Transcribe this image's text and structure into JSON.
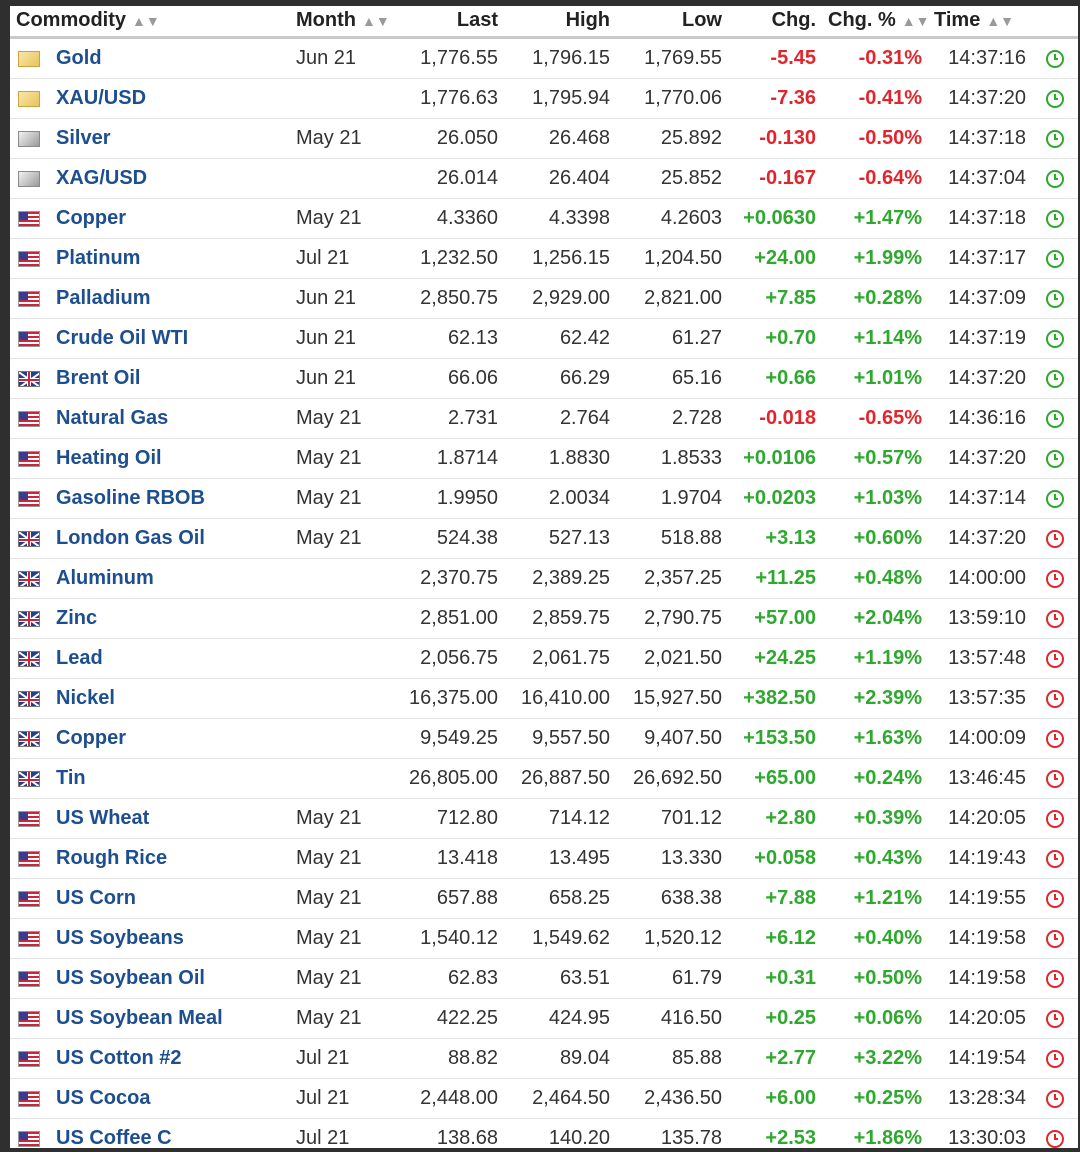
{
  "columns": {
    "commodity": "Commodity",
    "month": "Month",
    "last": "Last",
    "high": "High",
    "low": "Low",
    "chg": "Chg.",
    "chg_pct": "Chg. %",
    "time": "Time"
  },
  "sort_icon": "sort-icon",
  "colors": {
    "up": "#2ea82e",
    "down": "#e0262c",
    "link": "#1d4e8f",
    "open": "#2ea82e",
    "closed": "#e0262c"
  },
  "rows": [
    {
      "flag": "gold",
      "name": "Gold",
      "month": "Jun 21",
      "last": "1,776.55",
      "high": "1,796.15",
      "low": "1,769.55",
      "chg": "-5.45",
      "pct": "-0.31%",
      "time": "14:37:16",
      "dir": "down",
      "clock": "green"
    },
    {
      "flag": "gold",
      "name": "XAU/USD",
      "month": "",
      "last": "1,776.63",
      "high": "1,795.94",
      "low": "1,770.06",
      "chg": "-7.36",
      "pct": "-0.41%",
      "time": "14:37:20",
      "dir": "down",
      "clock": "green"
    },
    {
      "flag": "silver",
      "name": "Silver",
      "month": "May 21",
      "last": "26.050",
      "high": "26.468",
      "low": "25.892",
      "chg": "-0.130",
      "pct": "-0.50%",
      "time": "14:37:18",
      "dir": "down",
      "clock": "green"
    },
    {
      "flag": "silver",
      "name": "XAG/USD",
      "month": "",
      "last": "26.014",
      "high": "26.404",
      "low": "25.852",
      "chg": "-0.167",
      "pct": "-0.64%",
      "time": "14:37:04",
      "dir": "down",
      "clock": "green"
    },
    {
      "flag": "us",
      "name": "Copper",
      "month": "May 21",
      "last": "4.3360",
      "high": "4.3398",
      "low": "4.2603",
      "chg": "+0.0630",
      "pct": "+1.47%",
      "time": "14:37:18",
      "dir": "up",
      "clock": "green"
    },
    {
      "flag": "us",
      "name": "Platinum",
      "month": "Jul 21",
      "last": "1,232.50",
      "high": "1,256.15",
      "low": "1,204.50",
      "chg": "+24.00",
      "pct": "+1.99%",
      "time": "14:37:17",
      "dir": "up",
      "clock": "green"
    },
    {
      "flag": "us",
      "name": "Palladium",
      "month": "Jun 21",
      "last": "2,850.75",
      "high": "2,929.00",
      "low": "2,821.00",
      "chg": "+7.85",
      "pct": "+0.28%",
      "time": "14:37:09",
      "dir": "up",
      "clock": "green"
    },
    {
      "flag": "us",
      "name": "Crude Oil WTI",
      "month": "Jun 21",
      "last": "62.13",
      "high": "62.42",
      "low": "61.27",
      "chg": "+0.70",
      "pct": "+1.14%",
      "time": "14:37:19",
      "dir": "up",
      "clock": "green"
    },
    {
      "flag": "uk",
      "name": "Brent Oil",
      "month": "Jun 21",
      "last": "66.06",
      "high": "66.29",
      "low": "65.16",
      "chg": "+0.66",
      "pct": "+1.01%",
      "time": "14:37:20",
      "dir": "up",
      "clock": "green"
    },
    {
      "flag": "us",
      "name": "Natural Gas",
      "month": "May 21",
      "last": "2.731",
      "high": "2.764",
      "low": "2.728",
      "chg": "-0.018",
      "pct": "-0.65%",
      "time": "14:36:16",
      "dir": "down",
      "clock": "green"
    },
    {
      "flag": "us",
      "name": "Heating Oil",
      "month": "May 21",
      "last": "1.8714",
      "high": "1.8830",
      "low": "1.8533",
      "chg": "+0.0106",
      "pct": "+0.57%",
      "time": "14:37:20",
      "dir": "up",
      "clock": "green"
    },
    {
      "flag": "us",
      "name": "Gasoline RBOB",
      "month": "May 21",
      "last": "1.9950",
      "high": "2.0034",
      "low": "1.9704",
      "chg": "+0.0203",
      "pct": "+1.03%",
      "time": "14:37:14",
      "dir": "up",
      "clock": "green"
    },
    {
      "flag": "uk",
      "name": "London Gas Oil",
      "month": "May 21",
      "last": "524.38",
      "high": "527.13",
      "low": "518.88",
      "chg": "+3.13",
      "pct": "+0.60%",
      "time": "14:37:20",
      "dir": "up",
      "clock": "red"
    },
    {
      "flag": "uk",
      "name": "Aluminum",
      "month": "",
      "last": "2,370.75",
      "high": "2,389.25",
      "low": "2,357.25",
      "chg": "+11.25",
      "pct": "+0.48%",
      "time": "14:00:00",
      "dir": "up",
      "clock": "red"
    },
    {
      "flag": "uk",
      "name": "Zinc",
      "month": "",
      "last": "2,851.00",
      "high": "2,859.75",
      "low": "2,790.75",
      "chg": "+57.00",
      "pct": "+2.04%",
      "time": "13:59:10",
      "dir": "up",
      "clock": "red"
    },
    {
      "flag": "uk",
      "name": "Lead",
      "month": "",
      "last": "2,056.75",
      "high": "2,061.75",
      "low": "2,021.50",
      "chg": "+24.25",
      "pct": "+1.19%",
      "time": "13:57:48",
      "dir": "up",
      "clock": "red"
    },
    {
      "flag": "uk",
      "name": "Nickel",
      "month": "",
      "last": "16,375.00",
      "high": "16,410.00",
      "low": "15,927.50",
      "chg": "+382.50",
      "pct": "+2.39%",
      "time": "13:57:35",
      "dir": "up",
      "clock": "red"
    },
    {
      "flag": "uk",
      "name": "Copper",
      "month": "",
      "last": "9,549.25",
      "high": "9,557.50",
      "low": "9,407.50",
      "chg": "+153.50",
      "pct": "+1.63%",
      "time": "14:00:09",
      "dir": "up",
      "clock": "red"
    },
    {
      "flag": "uk",
      "name": "Tin",
      "month": "",
      "last": "26,805.00",
      "high": "26,887.50",
      "low": "26,692.50",
      "chg": "+65.00",
      "pct": "+0.24%",
      "time": "13:46:45",
      "dir": "up",
      "clock": "red"
    },
    {
      "flag": "us",
      "name": "US Wheat",
      "month": "May 21",
      "last": "712.80",
      "high": "714.12",
      "low": "701.12",
      "chg": "+2.80",
      "pct": "+0.39%",
      "time": "14:20:05",
      "dir": "up",
      "clock": "red"
    },
    {
      "flag": "us",
      "name": "Rough Rice",
      "month": "May 21",
      "last": "13.418",
      "high": "13.495",
      "low": "13.330",
      "chg": "+0.058",
      "pct": "+0.43%",
      "time": "14:19:43",
      "dir": "up",
      "clock": "red"
    },
    {
      "flag": "us",
      "name": "US Corn",
      "month": "May 21",
      "last": "657.88",
      "high": "658.25",
      "low": "638.38",
      "chg": "+7.88",
      "pct": "+1.21%",
      "time": "14:19:55",
      "dir": "up",
      "clock": "red"
    },
    {
      "flag": "us",
      "name": "US Soybeans",
      "month": "May 21",
      "last": "1,540.12",
      "high": "1,549.62",
      "low": "1,520.12",
      "chg": "+6.12",
      "pct": "+0.40%",
      "time": "14:19:58",
      "dir": "up",
      "clock": "red"
    },
    {
      "flag": "us",
      "name": "US Soybean Oil",
      "month": "May 21",
      "last": "62.83",
      "high": "63.51",
      "low": "61.79",
      "chg": "+0.31",
      "pct": "+0.50%",
      "time": "14:19:58",
      "dir": "up",
      "clock": "red"
    },
    {
      "flag": "us",
      "name": "US Soybean Meal",
      "month": "May 21",
      "last": "422.25",
      "high": "424.95",
      "low": "416.50",
      "chg": "+0.25",
      "pct": "+0.06%",
      "time": "14:20:05",
      "dir": "up",
      "clock": "red"
    },
    {
      "flag": "us",
      "name": "US Cotton #2",
      "month": "Jul 21",
      "last": "88.82",
      "high": "89.04",
      "low": "85.88",
      "chg": "+2.77",
      "pct": "+3.22%",
      "time": "14:19:54",
      "dir": "up",
      "clock": "red"
    },
    {
      "flag": "us",
      "name": "US Cocoa",
      "month": "Jul 21",
      "last": "2,448.00",
      "high": "2,464.50",
      "low": "2,436.50",
      "chg": "+6.00",
      "pct": "+0.25%",
      "time": "13:28:34",
      "dir": "up",
      "clock": "red"
    },
    {
      "flag": "us",
      "name": "US Coffee C",
      "month": "Jul 21",
      "last": "138.68",
      "high": "140.20",
      "low": "135.78",
      "chg": "+2.53",
      "pct": "+1.86%",
      "time": "13:30:03",
      "dir": "up",
      "clock": "red"
    }
  ]
}
